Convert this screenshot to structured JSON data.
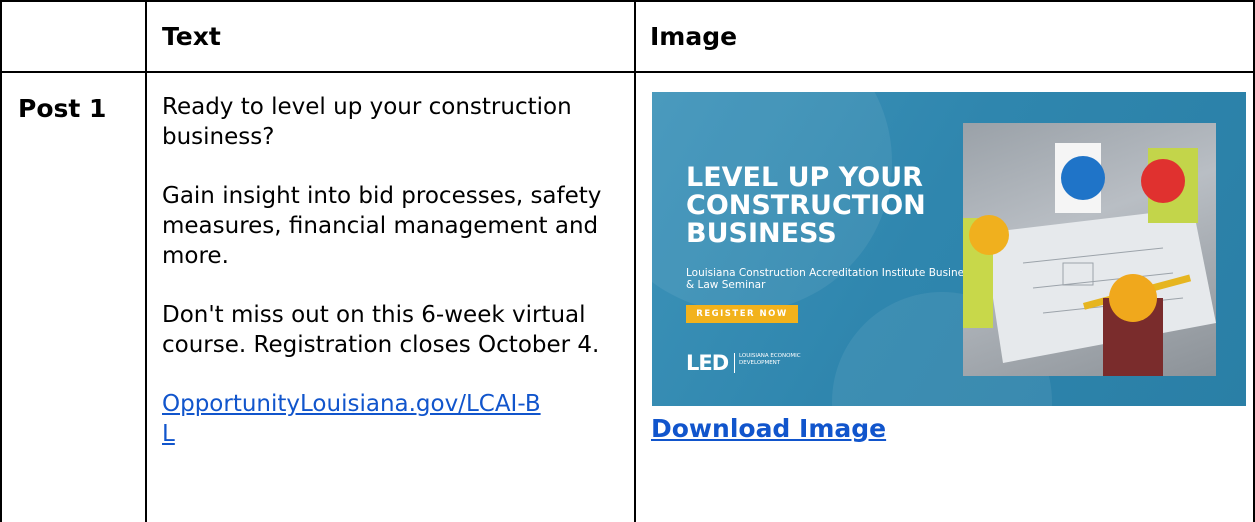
{
  "table": {
    "headers": [
      "",
      "Text",
      "Image"
    ],
    "rows": [
      {
        "label": "Post 1",
        "text_paragraphs": [
          "Ready to level up your construction business?",
          "Gain insight into bid processes, safety measures, financial management and more.",
          "Don't miss out on this 6-week virtual course. Registration closes October 4."
        ],
        "link_line1": "OpportunityLouisiana.gov/LCAI-B",
        "link_line2": "L",
        "image": {
          "headline": "LEVEL UP YOUR CONSTRUCTION BUSINESS",
          "subhead": "Louisiana Construction Accreditation Institute Business & Law Seminar",
          "cta": "REGISTER NOW",
          "logo_mark": "LED",
          "logo_org": "LOUISIANA ECONOMIC DEVELOPMENT",
          "photo_icon": "construction-workers-photo",
          "background_color": "#2f86ae",
          "cta_color": "#f2b21c"
        },
        "download_label": "Download Image"
      }
    ]
  },
  "colors": {
    "link": "#1155cc",
    "border": "#000000"
  }
}
